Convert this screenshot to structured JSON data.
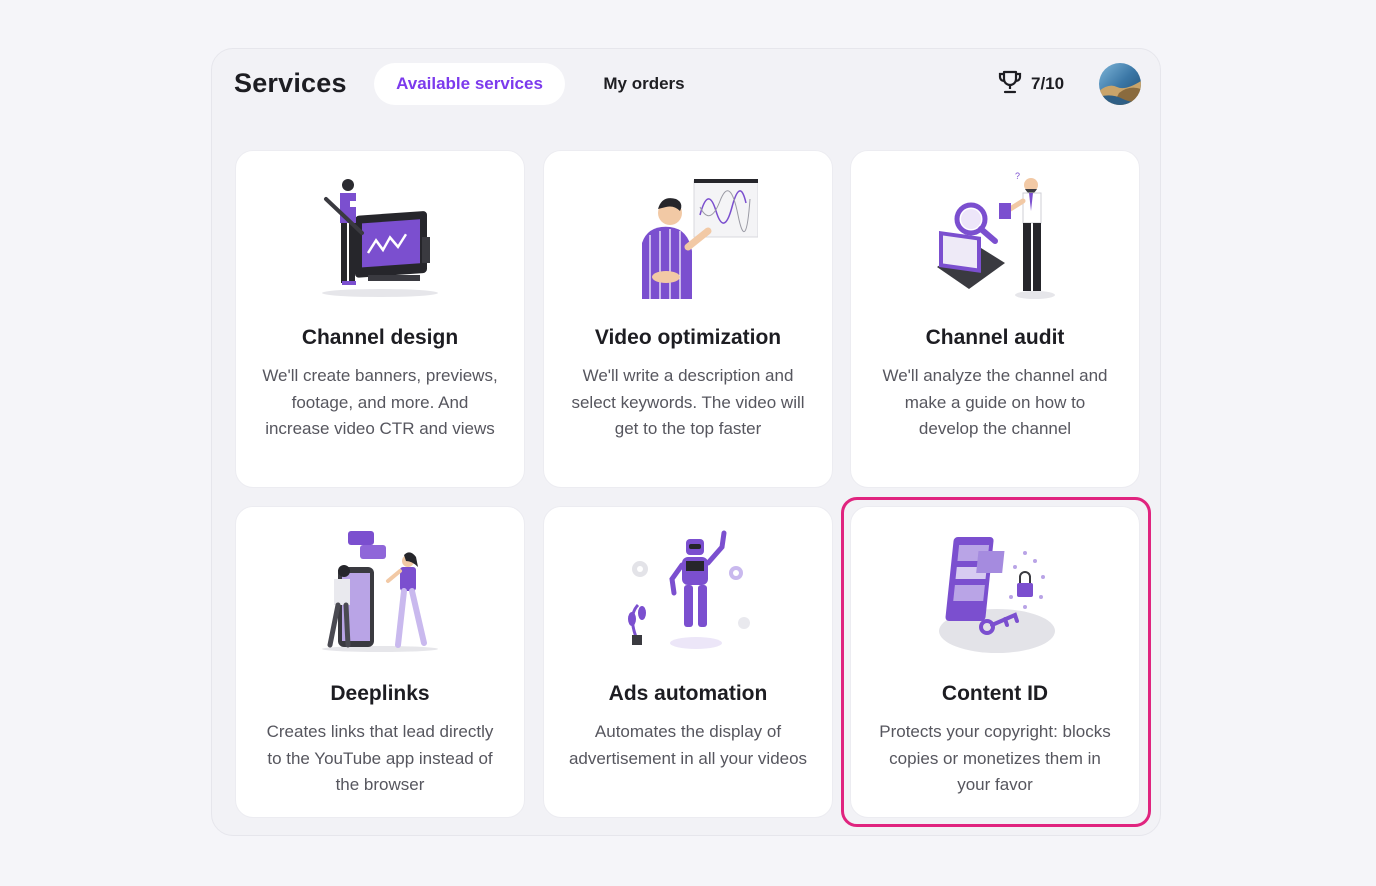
{
  "header": {
    "title": "Services",
    "tabs": [
      {
        "label": "Available services",
        "active": true
      },
      {
        "label": "My orders",
        "active": false
      }
    ],
    "score": "7/10",
    "score_icon": "trophy-icon",
    "avatar_icon": "user-avatar"
  },
  "colors": {
    "accent": "#7c3aed",
    "illustration": "#7b4fcf",
    "highlight": "#e0247f"
  },
  "services": [
    {
      "title": "Channel design",
      "description": "We'll create banners, previews, footage, and more. And increase video CTR and views",
      "illustration": "designer-tablet-illustration"
    },
    {
      "title": "Video optimization",
      "description": "We'll write a description and select keywords. The video will get to the top faster",
      "illustration": "presenter-chart-illustration"
    },
    {
      "title": "Channel audit",
      "description": "We'll analyze the channel and make a guide on how to develop the channel",
      "illustration": "magnifier-audit-illustration"
    },
    {
      "title": "Deeplinks",
      "description": "Creates links that lead directly to the YouTube app instead of the browser",
      "illustration": "phone-chat-illustration"
    },
    {
      "title": "Ads automation",
      "description": "Automates the display of advertisement in all your videos",
      "illustration": "robot-illustration"
    },
    {
      "title": "Content ID",
      "description": "Protects your copyright: blocks copies or monetizes them in your favor",
      "illustration": "lock-key-illustration",
      "highlighted": true
    }
  ]
}
